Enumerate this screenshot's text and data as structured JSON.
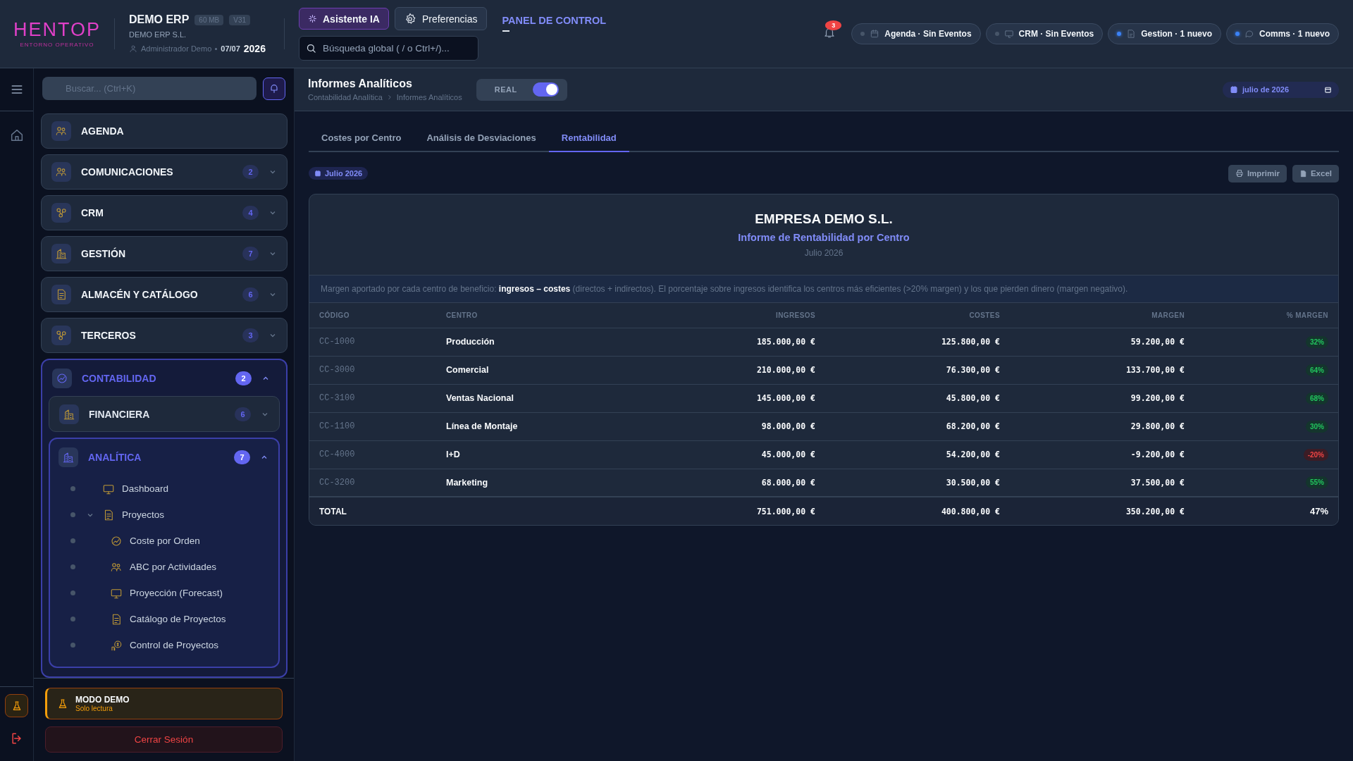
{
  "topbar": {
    "logo": "HENTOP",
    "logo_tagline": "ENTORNO OPERATIVO",
    "app_name": "DEMO ERP",
    "badges": [
      "60 MB",
      "V31"
    ],
    "company": "DEMO ERP S.L.",
    "user": "Administrador Demo",
    "date": "07/07",
    "year": "2026",
    "assistant_button": "Asistente IA",
    "preferences_button": "Preferencias",
    "search": {
      "placeholder": "Búsqueda global ( / o Ctrl+/)..."
    },
    "panel_link": "PANEL DE CONTROL",
    "notifications": "3",
    "pills": [
      {
        "label": "Agenda · Sin Eventos",
        "unread": false
      },
      {
        "label": "CRM · Sin Eventos",
        "unread": false
      },
      {
        "label": "Gestion · 1 nuevo",
        "unread": true
      },
      {
        "label": "Comms · 1 nuevo",
        "unread": true
      }
    ]
  },
  "sidebar": {
    "search": {
      "placeholder": "Buscar... (Ctrl+K)"
    },
    "items": [
      {
        "label": "AGENDA"
      },
      {
        "label": "COMUNICACIONES",
        "count": "2",
        "expanded": false
      },
      {
        "label": "CRM",
        "count": "4",
        "expanded": false
      },
      {
        "label": "GESTIÓN",
        "count": "7",
        "expanded": false
      },
      {
        "label": "ALMACÉN Y CATÁLOGO",
        "count": "6",
        "expanded": false
      },
      {
        "label": "TERCEROS",
        "count": "3",
        "expanded": false
      },
      {
        "label": "CONTABILIDAD",
        "count": "2",
        "expanded": true,
        "children": [
          {
            "label": "FINANCIERA",
            "count": "6",
            "expanded": false
          },
          {
            "label": "ANALÍTICA",
            "count": "7",
            "expanded": true,
            "children": [
              {
                "label": "Dashboard"
              },
              {
                "label": "Proyectos",
                "expanded": true,
                "children": [
                  {
                    "label": "Coste por Orden"
                  },
                  {
                    "label": "ABC por Actividades"
                  },
                  {
                    "label": "Proyección (Forecast)"
                  },
                  {
                    "label": "Catálogo de Proyectos"
                  },
                  {
                    "label": "Control de Proyectos"
                  }
                ]
              }
            ]
          }
        ]
      }
    ],
    "demo": {
      "title": "MODO DEMO",
      "subtitle": "Solo lectura"
    },
    "logout": "Cerrar Sesión"
  },
  "header": {
    "title": "Informes Analíticos",
    "breadcrumb": [
      "Contabilidad Analítica",
      "Informes Analíticos"
    ],
    "toggle": {
      "label": "REAL",
      "on": true
    },
    "date": "julio de 2026"
  },
  "tabs": [
    {
      "label": "Costes por Centro",
      "selected": false
    },
    {
      "label": "Análisis de Desviaciones",
      "selected": false
    },
    {
      "label": "Rentabilidad",
      "selected": true
    }
  ],
  "period": "Julio 2026",
  "actions": [
    "Imprimir",
    "Excel"
  ],
  "report": {
    "company": "EMPRESA DEMO S.L.",
    "title": "Informe de Rentabilidad por Centro",
    "period": "Julio 2026",
    "description": "Margen aportado por cada centro de beneficio: **ingresos – costes** (directos + indirectos). El porcentaje sobre ingresos identifica los centros más eficientes (>20% margen) y los que pierden dinero (margen negativo).",
    "columns": [
      "CÓDIGO",
      "CENTRO",
      "INGRESOS",
      "COSTES",
      "MARGEN",
      "% MARGEN"
    ],
    "rows": [
      {
        "code": "CC-1000",
        "center": "Producción",
        "income": "185.000,00 €",
        "costs": "125.800,00 €",
        "margin": "59.200,00 €",
        "pct": "32%",
        "negative": false
      },
      {
        "code": "CC-3000",
        "center": "Comercial",
        "income": "210.000,00 €",
        "costs": "76.300,00 €",
        "margin": "133.700,00 €",
        "pct": "64%",
        "negative": false
      },
      {
        "code": "CC-3100",
        "center": "Ventas Nacional",
        "income": "145.000,00 €",
        "costs": "45.800,00 €",
        "margin": "99.200,00 €",
        "pct": "68%",
        "negative": false
      },
      {
        "code": "CC-1100",
        "center": "Línea de Montaje",
        "income": "98.000,00 €",
        "costs": "68.200,00 €",
        "margin": "29.800,00 €",
        "pct": "30%",
        "negative": false
      },
      {
        "code": "CC-4000",
        "center": "I+D",
        "income": "45.000,00 €",
        "costs": "54.200,00 €",
        "margin": "-9.200,00 €",
        "pct": "-20%",
        "negative": true
      },
      {
        "code": "CC-3200",
        "center": "Marketing",
        "income": "68.000,00 €",
        "costs": "30.500,00 €",
        "margin": "37.500,00 €",
        "pct": "55%",
        "negative": false
      }
    ],
    "total": {
      "label": "TOTAL",
      "income": "751.000,00 €",
      "costs": "400.800,00 €",
      "margin": "350.200,00 €",
      "pct": "47%"
    }
  }
}
